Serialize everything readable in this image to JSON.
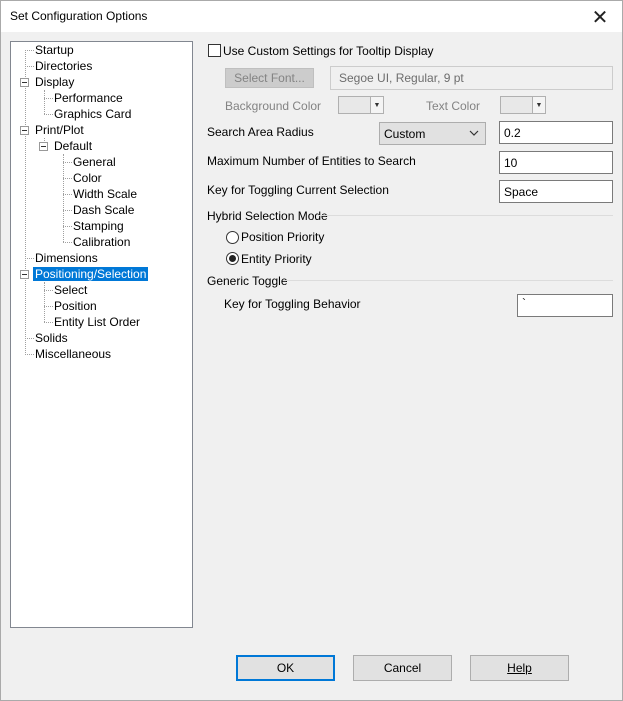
{
  "window": {
    "title": "Set Configuration Options"
  },
  "tree": {
    "items": [
      {
        "label": "Startup",
        "name": "startup"
      },
      {
        "label": "Directories",
        "name": "directories"
      },
      {
        "label": "Display",
        "name": "display"
      },
      {
        "label": "Performance",
        "name": "performance"
      },
      {
        "label": "Graphics Card",
        "name": "graphics-card"
      },
      {
        "label": "Print/Plot",
        "name": "print-plot"
      },
      {
        "label": "Default",
        "name": "default"
      },
      {
        "label": "General",
        "name": "general"
      },
      {
        "label": "Color",
        "name": "color"
      },
      {
        "label": "Width Scale",
        "name": "width-scale"
      },
      {
        "label": "Dash Scale",
        "name": "dash-scale"
      },
      {
        "label": "Stamping",
        "name": "stamping"
      },
      {
        "label": "Calibration",
        "name": "calibration"
      },
      {
        "label": "Dimensions",
        "name": "dimensions"
      },
      {
        "label": "Positioning/Selection",
        "name": "positioning-selection"
      },
      {
        "label": "Select",
        "name": "select"
      },
      {
        "label": "Position",
        "name": "position"
      },
      {
        "label": "Entity List Order",
        "name": "entity-list-order"
      },
      {
        "label": "Solids",
        "name": "solids"
      },
      {
        "label": "Miscellaneous",
        "name": "miscellaneous"
      }
    ]
  },
  "tooltip": {
    "use_custom_label": "Use Custom Settings for Tooltip Display",
    "select_font_label": "Select Font...",
    "font_value": "Segoe UI, Regular, 9 pt",
    "background_color_label": "Background Color",
    "text_color_label": "Text Color"
  },
  "search": {
    "radius_label": "Search Area Radius",
    "radius_mode": "Custom",
    "radius_value": "0.2",
    "max_entities_label": "Maximum Number of Entities to Search",
    "max_entities_value": "10",
    "toggle_key_label": "Key for Toggling Current Selection",
    "toggle_key_value": "Space"
  },
  "hybrid": {
    "group_label": "Hybrid Selection Mode",
    "position_priority_label": "Position Priority",
    "entity_priority_label": "Entity Priority"
  },
  "generic": {
    "group_label": "Generic Toggle",
    "key_label": "Key for Toggling Behavior",
    "key_value": "`"
  },
  "buttons": {
    "ok": "OK",
    "cancel": "Cancel",
    "help": "Help"
  }
}
